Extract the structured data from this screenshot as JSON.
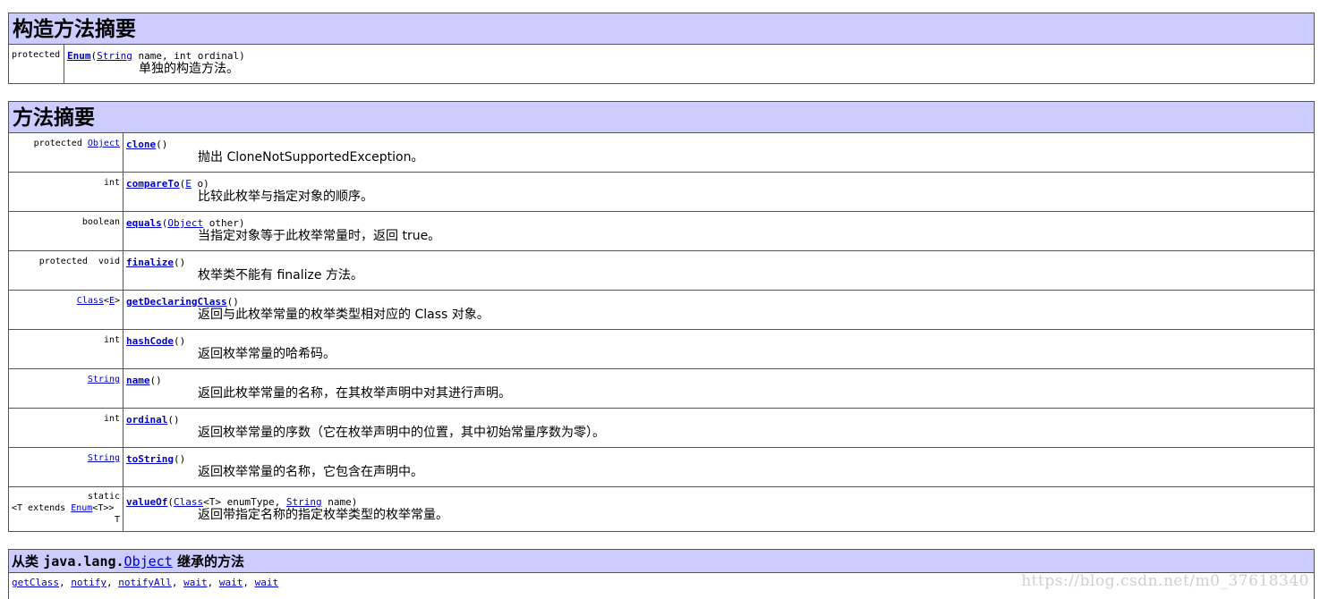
{
  "constructor_summary": {
    "title": "构造方法摘要",
    "rows": [
      {
        "modifier": "protected",
        "name": "Enum",
        "open": "(",
        "param_type": "String",
        "params_rest": " name, int ordinal)",
        "description": "单独的构造方法。"
      }
    ]
  },
  "method_summary": {
    "title": "方法摘要",
    "rows": [
      {
        "mod": "protected ",
        "type_link": "Object",
        "name": "clone",
        "sig": "()",
        "description": "抛出 CloneNotSupportedException。"
      },
      {
        "mod": "int",
        "name": "compareTo",
        "sig_open": "(",
        "param_link": "E",
        "sig_rest": " o)",
        "description": "比较此枚举与指定对象的顺序。"
      },
      {
        "mod": "boolean",
        "name": "equals",
        "sig_open": "(",
        "param_link": "Object",
        "sig_rest": " other)",
        "description": "当指定对象等于此枚举常量时，返回 true。"
      },
      {
        "mod": "protected  void",
        "name": "finalize",
        "sig": "()",
        "description": "枚举类不能有 finalize 方法。"
      },
      {
        "type_link": "Class",
        "type_rest": "<",
        "type_link2": "E",
        "type_end": ">",
        "name": "getDeclaringClass",
        "sig": "()",
        "description": "返回与此枚举常量的枚举类型相对应的 Class 对象。"
      },
      {
        "mod": "int",
        "name": "hashCode",
        "sig": "()",
        "description": "返回枚举常量的哈希码。"
      },
      {
        "type_link": "String",
        "name": "name",
        "sig": "()",
        "description": "返回此枚举常量的名称，在其枚举声明中对其进行声明。"
      },
      {
        "mod": "int",
        "name": "ordinal",
        "sig": "()",
        "description": "返回枚举常量的序数（它在枚举声明中的位置，其中初始常量序数为零）。"
      },
      {
        "type_link": "String",
        "name": "toString",
        "sig": "()",
        "description": "返回枚举常量的名称，它包含在声明中。"
      },
      {
        "mod_line1": "static",
        "mod_line2_a": "<T extends ",
        "mod_line2_link": "Enum",
        "mod_line2_b": "<T>>",
        "mod_line3": "T",
        "name": "valueOf",
        "sig_open": "(",
        "param_link": "Class",
        "sig_mid": "<T> enumType, ",
        "param_link2": "String",
        "sig_rest": " name)",
        "description": "返回带指定名称的指定枚举类型的枚举常量。"
      }
    ]
  },
  "inherited": {
    "title_prefix": "从类 ",
    "title_pkg": "java.lang.",
    "title_link": "Object",
    "title_suffix": " 继承的方法",
    "methods": [
      "getClass",
      "notify",
      "notifyAll",
      "wait",
      "wait",
      "wait"
    ],
    "separator": ", "
  },
  "watermark": "https://blog.csdn.net/m0_37618340"
}
